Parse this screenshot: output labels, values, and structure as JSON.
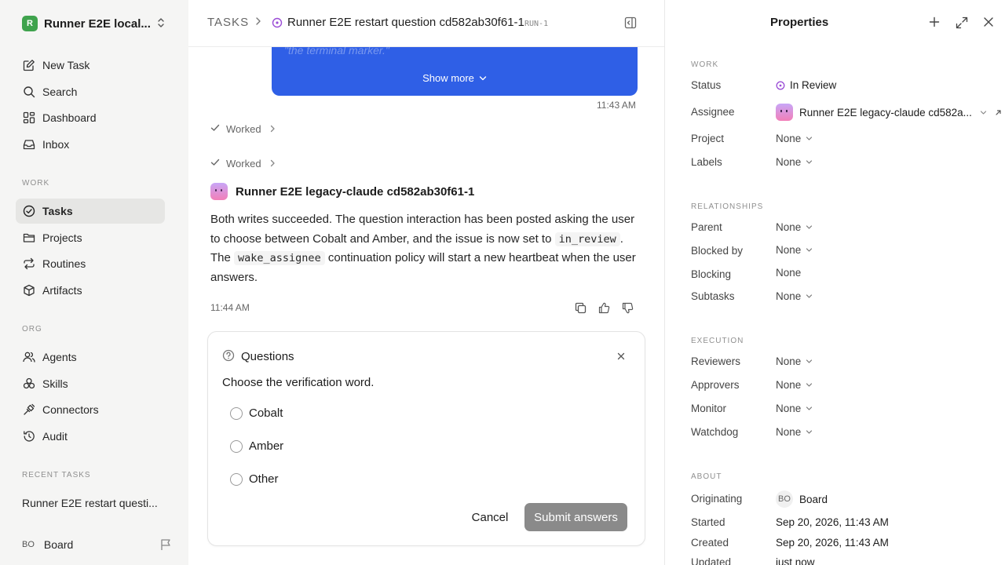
{
  "workspace": {
    "logo_letter": "R",
    "name": "Runner E2E local..."
  },
  "nav": {
    "new_task": "New Task",
    "search": "Search",
    "dashboard": "Dashboard",
    "inbox": "Inbox"
  },
  "work_section": {
    "label": "WORK",
    "tasks": "Tasks",
    "projects": "Projects",
    "routines": "Routines",
    "artifacts": "Artifacts"
  },
  "org_section": {
    "label": "ORG",
    "agents": "Agents",
    "skills": "Skills",
    "connectors": "Connectors",
    "audit": "Audit"
  },
  "recent": {
    "label": "RECENT TASKS",
    "item": "Runner E2E restart questi..."
  },
  "footer": {
    "initials": "BO",
    "name": "Board"
  },
  "breadcrumb": {
    "root": "TASKS",
    "title": "Runner E2E restart question cd582ab30f61-1",
    "id": "RUN-1"
  },
  "thread": {
    "blue_card_fade_text": "\"the terminal marker.\"",
    "show_more": "Show more",
    "time_1": "11:43 AM",
    "worked_1": "Worked",
    "worked_2": "Worked",
    "agent_name": "Runner E2E legacy-claude cd582ab30f61-1",
    "message_part1": "Both writes succeeded. The question interaction has been posted asking the user to choose between Cobalt and Amber, and the issue is now set to",
    "message_code1": "in_review",
    "message_part2": ". The",
    "message_code2": "wake_assignee",
    "message_part3": "continuation policy will start a new heartbeat when the user answers.",
    "time_2": "11:44 AM"
  },
  "questions": {
    "title": "Questions",
    "prompt": "Choose the verification word.",
    "options": [
      "Cobalt",
      "Amber",
      "Other"
    ],
    "cancel": "Cancel",
    "submit": "Submit answers"
  },
  "properties": {
    "title": "Properties",
    "work_label": "WORK",
    "status_key": "Status",
    "status_value": "In Review",
    "assignee_key": "Assignee",
    "assignee_value": "Runner E2E legacy-claude cd582a...",
    "project_key": "Project",
    "project_value": "None",
    "labels_key": "Labels",
    "labels_value": "None",
    "relationships_label": "RELATIONSHIPS",
    "parent_key": "Parent",
    "parent_value": "None",
    "blocked_by_key": "Blocked by",
    "blocked_by_value": "None",
    "blocking_key": "Blocking",
    "blocking_value": "None",
    "subtasks_key": "Subtasks",
    "subtasks_value": "None",
    "execution_label": "EXECUTION",
    "reviewers_key": "Reviewers",
    "reviewers_value": "None",
    "approvers_key": "Approvers",
    "approvers_value": "None",
    "monitor_key": "Monitor",
    "monitor_value": "None",
    "watchdog_key": "Watchdog",
    "watchdog_value": "None",
    "about_label": "ABOUT",
    "originating_key": "Originating",
    "originating_initials": "BO",
    "originating_value": "Board",
    "started_key": "Started",
    "started_value": "Sep 20, 2026, 11:43 AM",
    "created_key": "Created",
    "created_value": "Sep 20, 2026, 11:43 AM",
    "updated_key": "Updated",
    "updated_value": "just now"
  },
  "colors": {
    "accent_blue": "#2f5fe6",
    "status_purple": "#9b4dd6",
    "workspace_green": "#3fa34d",
    "submit_disabled": "#8a8a8a"
  }
}
